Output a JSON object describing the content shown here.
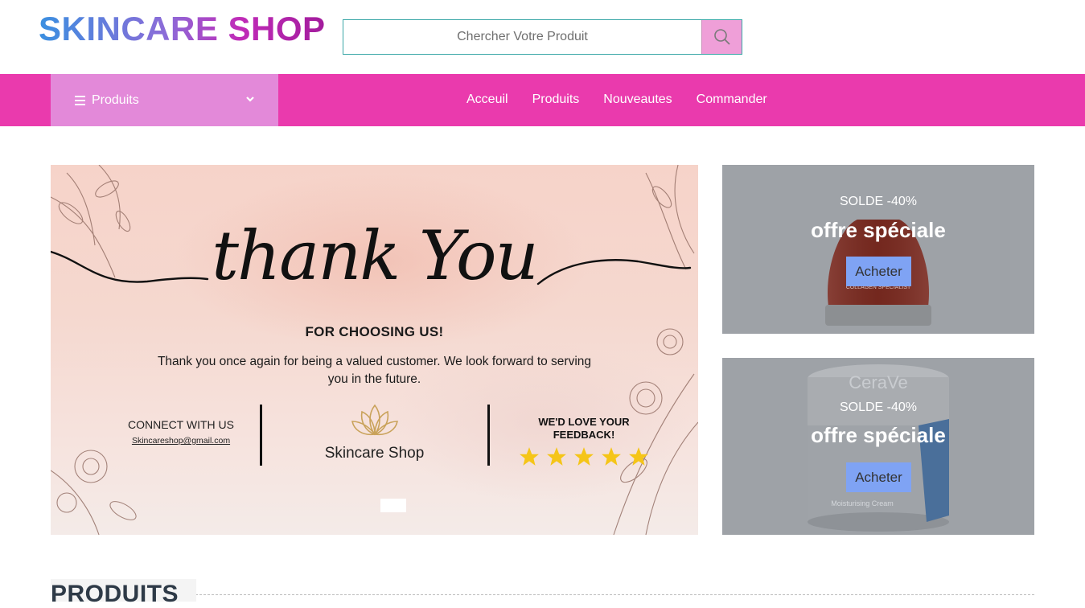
{
  "header": {
    "logo": "SKINCARE SHOP",
    "search_placeholder": "Chercher Votre Produit"
  },
  "nav": {
    "category_label": "Produits",
    "links": [
      "Acceuil",
      "Produits",
      "Nouveautes",
      "Commander"
    ]
  },
  "hero": {
    "title": "thank You",
    "subtitle": "FOR CHOOSING US!",
    "body": "Thank you once again for being a valued customer. We look forward to serving you in the future.",
    "connect_title": "CONNECT WITH US",
    "connect_email": "Skincareshop@gmail.com",
    "brand_name": "Skincare Shop",
    "feedback_title": "WE'D LOVE YOUR FEEDBACK!",
    "rating_stars": 5
  },
  "promos": [
    {
      "sale": "SOLDE -40%",
      "offer": "offre spéciale",
      "button": "Acheter",
      "jar_label": "COLLAGEN SPECIALIST"
    },
    {
      "sale": "SOLDE -40%",
      "offer": "offre spéciale",
      "button": "Acheter",
      "jar_brand": "CeraVe",
      "jar_label": "Moisturising Cream"
    }
  ],
  "section": {
    "title": "PRODUITS"
  },
  "colors": {
    "nav_bg": "#ea3aad",
    "dropdown_bg": "#e389d9",
    "search_btn": "#ef9fd8",
    "promo_bg": "#9ea2a7",
    "buy_btn": "#7fa3f4",
    "star": "#f5c518"
  }
}
